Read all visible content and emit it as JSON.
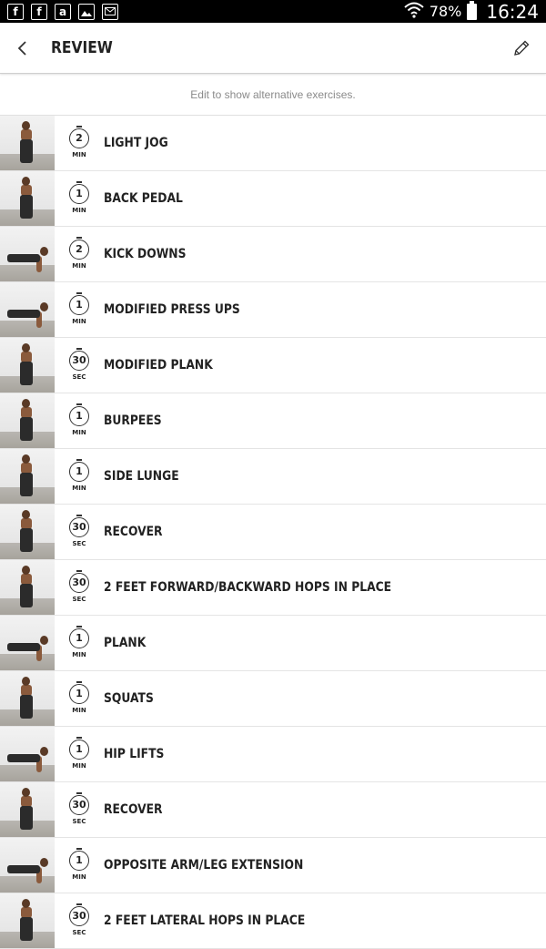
{
  "status_bar": {
    "notifications": [
      {
        "icon": "facebook-icon",
        "glyph": "f"
      },
      {
        "icon": "facebook-icon",
        "glyph": "f"
      },
      {
        "icon": "kindle-icon",
        "glyph": "a"
      },
      {
        "icon": "gallery-icon",
        "glyph": ""
      },
      {
        "icon": "email-icon",
        "glyph": ""
      }
    ],
    "battery": "78%",
    "time": "16:24"
  },
  "app_bar": {
    "title": "REVIEW"
  },
  "hint": "Edit to show alternative exercises.",
  "exercises": [
    {
      "name": "LIGHT JOG",
      "duration": "2",
      "unit": "MIN"
    },
    {
      "name": "BACK PEDAL",
      "duration": "1",
      "unit": "MIN"
    },
    {
      "name": "KICK DOWNS",
      "duration": "2",
      "unit": "MIN"
    },
    {
      "name": "MODIFIED PRESS UPS",
      "duration": "1",
      "unit": "MIN"
    },
    {
      "name": "MODIFIED PLANK",
      "duration": "30",
      "unit": "SEC"
    },
    {
      "name": "BURPEES",
      "duration": "1",
      "unit": "MIN"
    },
    {
      "name": "SIDE LUNGE",
      "duration": "1",
      "unit": "MIN"
    },
    {
      "name": "RECOVER",
      "duration": "30",
      "unit": "SEC"
    },
    {
      "name": "2 FEET FORWARD/BACKWARD HOPS IN PLACE",
      "duration": "30",
      "unit": "SEC"
    },
    {
      "name": "PLANK",
      "duration": "1",
      "unit": "MIN"
    },
    {
      "name": "SQUATS",
      "duration": "1",
      "unit": "MIN"
    },
    {
      "name": "HIP LIFTS",
      "duration": "1",
      "unit": "MIN"
    },
    {
      "name": "RECOVER",
      "duration": "30",
      "unit": "SEC"
    },
    {
      "name": "OPPOSITE ARM/LEG EXTENSION",
      "duration": "1",
      "unit": "MIN"
    },
    {
      "name": "2 FEET LATERAL HOPS IN PLACE",
      "duration": "30",
      "unit": "SEC"
    }
  ]
}
